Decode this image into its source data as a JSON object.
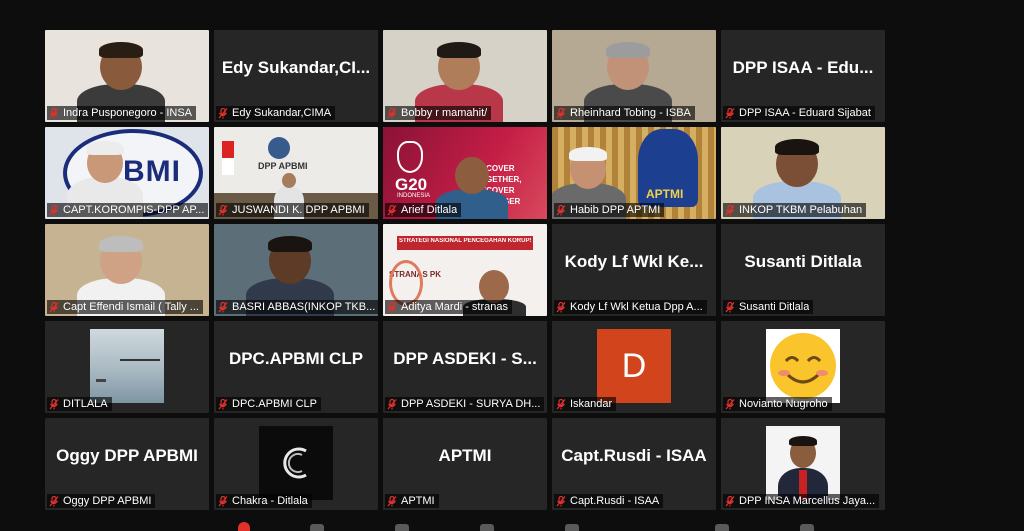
{
  "participants": [
    {
      "label": "Indra Pusponegoro - INSA",
      "display": "",
      "kind": "video-person",
      "bg": "#e8e3dc",
      "skin": "#8a5a3c",
      "shirt": "#3b3b3b",
      "hair": "#2a1d14"
    },
    {
      "label": "Edy Sukandar,CIMA",
      "display": "Edy  Sukandar,CI...",
      "kind": "name"
    },
    {
      "label": "Bobby r mamahit/",
      "display": "",
      "kind": "video-person",
      "bg": "#d7d2c8",
      "skin": "#b07d5a",
      "shirt": "#b8384a",
      "hair": "#1f1a16"
    },
    {
      "label": "Rheinhard Tobing - ISBA",
      "display": "",
      "kind": "video-person",
      "bg": "#b6a994",
      "skin": "#c19277",
      "shirt": "#4a4a4a",
      "hair": "#9c9c9c"
    },
    {
      "label": "DPP ISAA - Eduard Sijabat",
      "display": "DPP ISAA - Edu...",
      "kind": "name"
    },
    {
      "label": "CAPT.KOROMPIS-DPP AP...",
      "display": "",
      "kind": "video-logo",
      "bg": "#dfe3ea",
      "skin": "#c89878",
      "shirt": "#e9e9e9",
      "hair": "#ececec",
      "logo": "BMI",
      "logoColor": "#1b2c7a"
    },
    {
      "label": "JUSWANDI K. DPP APBMI",
      "display": "",
      "kind": "video-office",
      "bg": "#ecebe8",
      "signText": "DPP APBMI",
      "skin": "#a77c5d",
      "shirt": "#e4e4e4"
    },
    {
      "label": "Arief Ditlala",
      "display": "",
      "kind": "video-g20",
      "bg": "#b8173b",
      "bannerText": "RECOVER TOGETHER, RECOVER STRONGER",
      "g20": "G20",
      "g20sub": "INDONESIA",
      "skin": "#8c5d3e",
      "shirt": "#315f8c"
    },
    {
      "label": "Habib DPP APTMI",
      "display": "",
      "kind": "video-logo2",
      "bg": "#c79a4a",
      "skin": "#c69173",
      "shirt": "#6a6a6a",
      "hair": "#f2f2f2",
      "logo": "APTMI",
      "logoColor": "#1d3f8f"
    },
    {
      "label": "INKOP TKBM Pelabuhan",
      "display": "",
      "kind": "video-person",
      "bg": "#d8d2b9",
      "skin": "#7a4f35",
      "shirt": "#a9c2df",
      "hair": "#1a1410"
    },
    {
      "label": "Capt Effendi Ismail ( Tally ...",
      "display": "",
      "kind": "video-person",
      "bg": "#c6b392",
      "skin": "#cfa286",
      "shirt": "#f1f1f1",
      "hair": "#bdbdbd"
    },
    {
      "label": "BASRI ABBAS(INKOP TKB...",
      "display": "",
      "kind": "video-person",
      "bg": "#5c6e78",
      "skin": "#5d3b26",
      "shirt": "#303a4a",
      "hair": "#1a1410"
    },
    {
      "label": "Aditya Mardi - stranas",
      "display": "",
      "kind": "video-stranas",
      "bg": "#f3f0ee",
      "bannerText": "STRATEGI NASIONAL PENCEGAHAN KORUPSI",
      "sub": "STRANAS PK",
      "skin": "#9c6a4b",
      "shirt": "#2e2e2e"
    },
    {
      "label": "Kody Lf Wkl Ketua Dpp A...",
      "display": "Kody Lf Wkl Ke...",
      "kind": "name"
    },
    {
      "label": "Susanti Ditlala",
      "display": "Susanti Ditlala",
      "kind": "name"
    },
    {
      "label": "DITLALA",
      "display": "",
      "kind": "thumb-sea",
      "bg": "#262626"
    },
    {
      "label": "DPC.APBMI CLP",
      "display": "DPC.APBMI CLP",
      "kind": "name"
    },
    {
      "label": "DPP ASDEKI - SURYA DH...",
      "display": "DPP ASDEKI - S...",
      "kind": "name"
    },
    {
      "label": "Iskandar",
      "display": "",
      "kind": "avatar-letter",
      "letter": "D",
      "color": "#d2441c"
    },
    {
      "label": "Novianto Nugroho",
      "display": "",
      "kind": "avatar-emoji"
    },
    {
      "label": "Oggy DPP APBMI",
      "display": "Oggy DPP APBMI",
      "kind": "name"
    },
    {
      "label": "Chakra - Ditlala",
      "display": "",
      "kind": "avatar-c"
    },
    {
      "label": "APTMI",
      "display": "APTMI",
      "kind": "name"
    },
    {
      "label": "Capt.Rusdi - ISAA",
      "display": "Capt.Rusdi - ISAA",
      "kind": "name"
    },
    {
      "label": "DPP INSA Marcellus Jaya...",
      "display": "",
      "kind": "avatar-photo"
    }
  ],
  "active_index": 7,
  "colors": {
    "active_outline": "#d7e93b",
    "mic_muted": "#e0312b",
    "tile_bg": "#262626",
    "app_bg": "#0d0d0d"
  },
  "icons": {
    "muted": "mic-muted-icon"
  }
}
